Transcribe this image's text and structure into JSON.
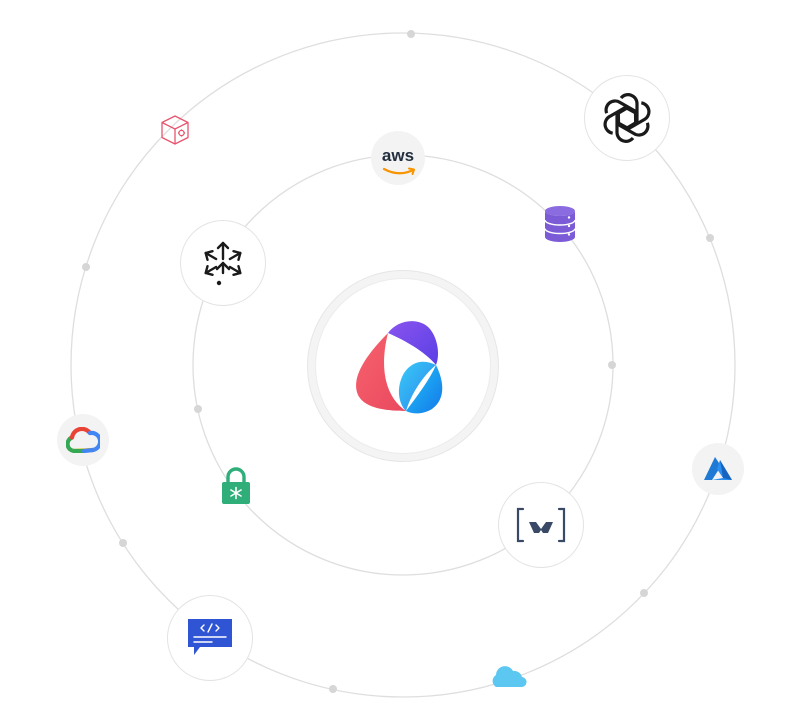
{
  "diagram": {
    "center": {
      "icon": "brand-logo-icon"
    },
    "nodes": [
      {
        "id": "openai",
        "icon": "openai-icon"
      },
      {
        "id": "aws",
        "icon": "aws-icon",
        "label": "aws"
      },
      {
        "id": "database",
        "icon": "database-icon"
      },
      {
        "id": "package",
        "icon": "package-box-icon"
      },
      {
        "id": "distributed",
        "icon": "distributed-arrows-icon"
      },
      {
        "id": "google-cloud",
        "icon": "google-cloud-icon"
      },
      {
        "id": "secret-lock",
        "icon": "secret-lock-icon"
      },
      {
        "id": "azure",
        "icon": "azure-icon"
      },
      {
        "id": "webhook",
        "icon": "webhook-brackets-icon"
      },
      {
        "id": "code-chat",
        "icon": "code-chat-icon"
      },
      {
        "id": "cloud",
        "icon": "cloud-icon"
      }
    ],
    "colors": {
      "orbit": "#dedede",
      "brand_red": "#f2586c",
      "brand_purple": "#7a4cf0",
      "brand_blue": "#1aa6f5",
      "database": "#7b5bd6",
      "lock": "#2fae7a",
      "code_chat": "#2f55d4",
      "azure": "#1f7ad6",
      "cloud": "#5cc7f0"
    }
  }
}
